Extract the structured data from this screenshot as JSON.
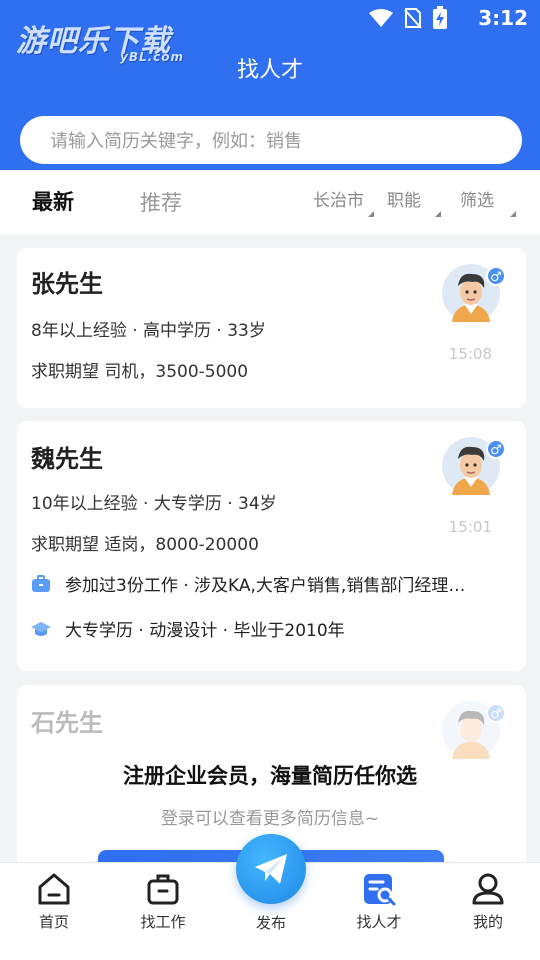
{
  "status": {
    "time": "3:12"
  },
  "watermark": {
    "main": "游吧乐下载",
    "sub": "yBL.com"
  },
  "header": {
    "title": "找人才"
  },
  "search": {
    "placeholder": "请输入简历关键字，例如：销售"
  },
  "filters": {
    "tabs": [
      {
        "label": "最新",
        "active": true
      },
      {
        "label": "推荐",
        "active": false
      }
    ],
    "city": "长治市",
    "job": "职能",
    "filter": "筛选"
  },
  "candidates": [
    {
      "name": "张先生",
      "meta": "8年以上经验 · 高中学历 · 33岁",
      "want": "求职期望 司机，3500-5000",
      "time": "15:08",
      "gender_symbol": "♂"
    },
    {
      "name": "魏先生",
      "meta": "10年以上经验 · 大专学历 · 34岁",
      "want": "求职期望 适岗，8000-20000",
      "time": "15:01",
      "gender_symbol": "♂",
      "work": "参加过3份工作 · 涉及KA,大客户销售,销售部门经理…",
      "edu": "大专学历 · 动漫设计 · 毕业于2010年"
    },
    {
      "name": "石先生",
      "gender_symbol": "♂"
    }
  ],
  "promo": {
    "title": "注册企业会员，海量简历任你选",
    "subtitle": "登录可以查看更多简历信息~"
  },
  "nav": {
    "items": [
      {
        "label": "首页",
        "icon": "home-icon"
      },
      {
        "label": "找工作",
        "icon": "briefcase-icon"
      },
      {
        "label": "发布",
        "icon": "paper-plane-icon"
      },
      {
        "label": "找人才",
        "icon": "talent-search-icon",
        "active": true
      },
      {
        "label": "我的",
        "icon": "user-icon"
      }
    ]
  },
  "colors": {
    "brand": "#2f6ff0",
    "publish": "#1e88e5",
    "gender": "#4a90f0"
  }
}
